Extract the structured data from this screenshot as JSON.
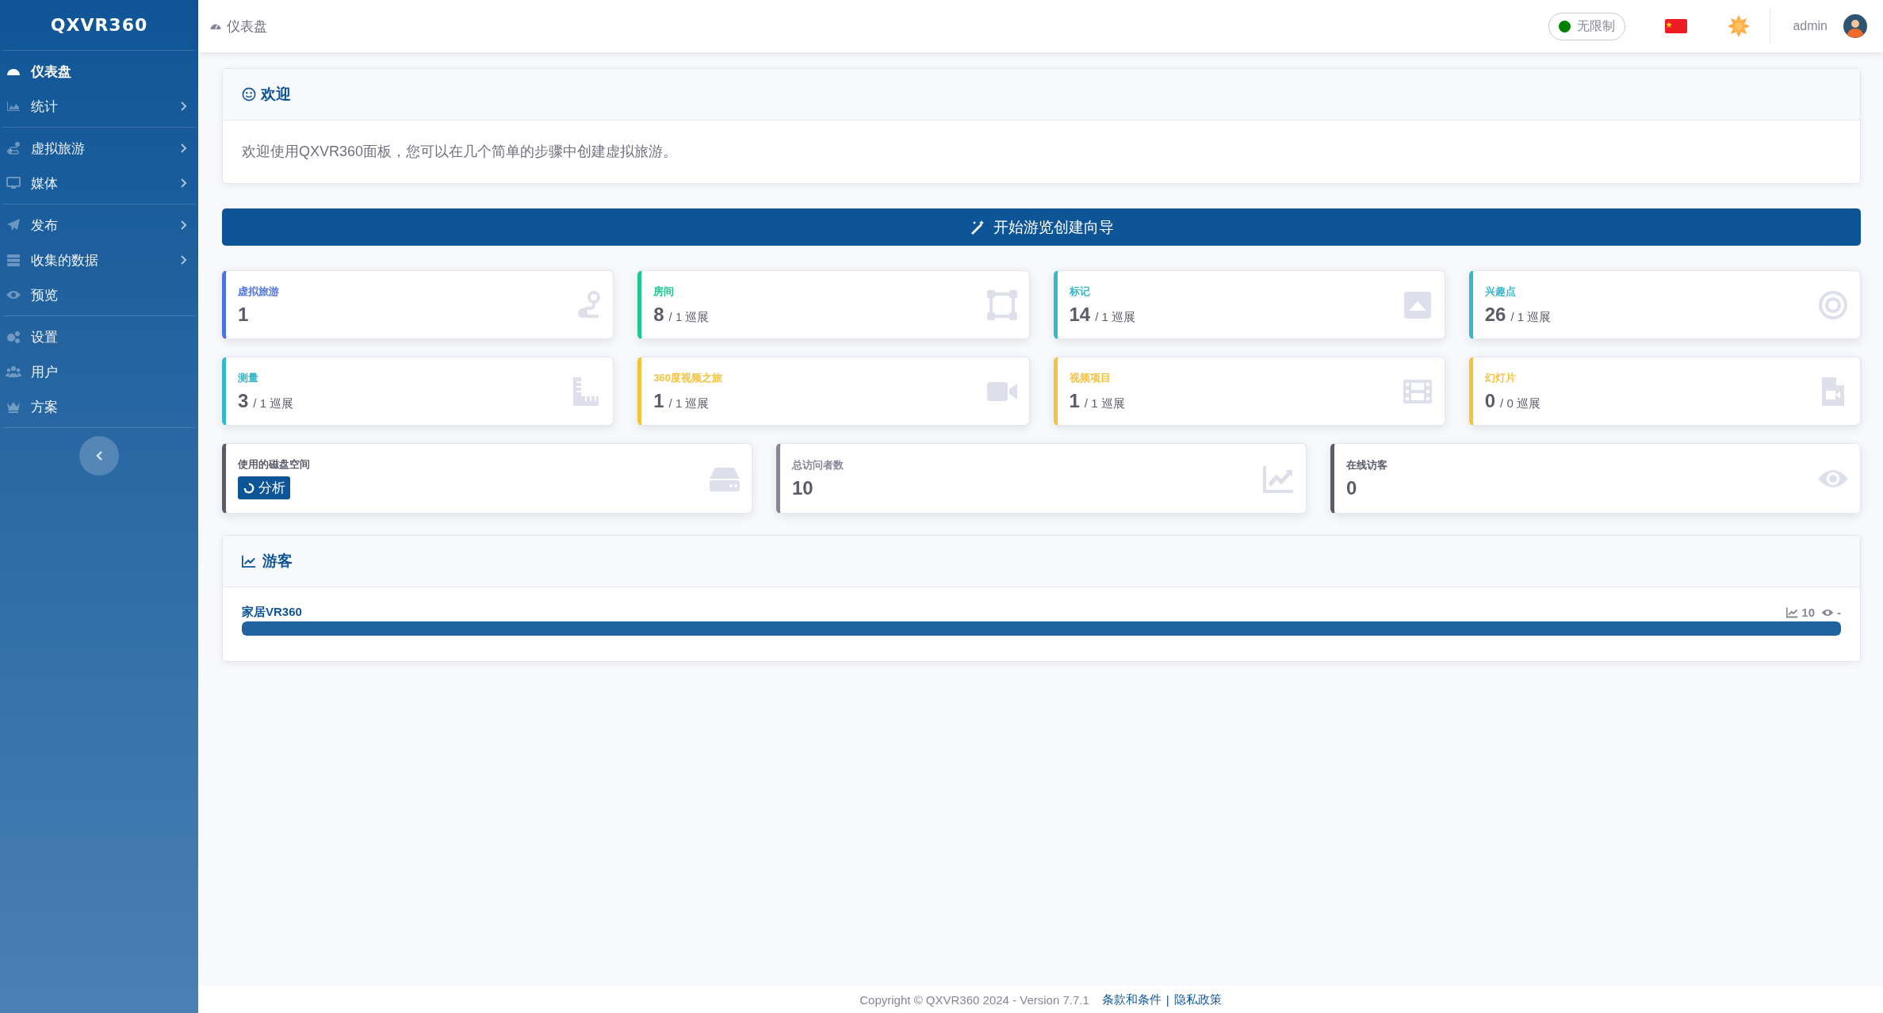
{
  "sidebar": {
    "logo": "QXVR360",
    "groups": [
      {
        "items": [
          {
            "label": "仪表盘",
            "selected": true,
            "expandable": false
          },
          {
            "label": "统计",
            "selected": false,
            "expandable": true
          }
        ]
      },
      {
        "items": [
          {
            "label": "虚拟旅游",
            "selected": false,
            "expandable": true
          },
          {
            "label": "媒体",
            "selected": false,
            "expandable": true
          }
        ]
      },
      {
        "items": [
          {
            "label": "发布",
            "selected": false,
            "expandable": true
          },
          {
            "label": "收集的数据",
            "selected": false,
            "expandable": true
          },
          {
            "label": "预览",
            "selected": false,
            "expandable": false
          }
        ]
      },
      {
        "items": [
          {
            "label": "设置",
            "selected": false,
            "expandable": false
          },
          {
            "label": "用户",
            "selected": false,
            "expandable": false
          },
          {
            "label": "方案",
            "selected": false,
            "expandable": false
          }
        ]
      }
    ]
  },
  "topbar": {
    "breadcrumb": "仪表盘",
    "status": {
      "label": "无限制",
      "color": "#008000"
    },
    "user": "admin"
  },
  "welcome": {
    "title": "欢迎",
    "text": "欢迎使用QXVR360面板，您可以在几个简单的步骤中创建虚拟旅游。"
  },
  "wizard_button": "开始游览创建向导",
  "stat_rows": [
    {
      "cards": [
        {
          "kind": "count",
          "label": "虚拟旅游",
          "value": "1",
          "color": "#4e73df"
        },
        {
          "kind": "count",
          "label": "房间",
          "value": "8",
          "suffix": "/ 1 巡展",
          "color": "#1cc88a"
        },
        {
          "kind": "count",
          "label": "标记",
          "value": "14",
          "suffix": "/ 1 巡展",
          "color": "#36b9cc"
        },
        {
          "kind": "count",
          "label": "兴趣点",
          "value": "26",
          "suffix": "/ 1 巡展",
          "color": "#36b9cc"
        }
      ]
    },
    {
      "cards": [
        {
          "kind": "count",
          "label": "测量",
          "value": "3",
          "suffix": "/ 1 巡展",
          "color": "#36b9cc"
        },
        {
          "kind": "count",
          "label": "360度视频之旅",
          "value": "1",
          "suffix": "/ 1 巡展",
          "color": "#f6c23e"
        },
        {
          "kind": "count",
          "label": "视频项目",
          "value": "1",
          "suffix": "/ 1 巡展",
          "color": "#f6c23e"
        },
        {
          "kind": "count",
          "label": "幻灯片",
          "value": "0",
          "suffix": "/ 0 巡展",
          "color": "#f6c23e"
        }
      ]
    },
    {
      "cards": [
        {
          "kind": "action",
          "label": "使用的磁盘空间",
          "button": "分析",
          "color": "#5a5c69"
        },
        {
          "kind": "count",
          "label": "总访问者数",
          "value": "10",
          "color": "#858796"
        },
        {
          "kind": "count",
          "label": "在线访客",
          "value": "0",
          "color": "#5a5c69"
        }
      ]
    }
  ],
  "visitors": {
    "title": "游客",
    "tours": [
      {
        "name": "家居VR360",
        "visits": "10",
        "online": "-",
        "level": 1
      }
    ]
  },
  "footer": {
    "copyright": "Copyright © QXVR360 2024 - Version 7.7.1",
    "links": [
      {
        "label": "条款和条件"
      },
      {
        "label": "隐私政策"
      }
    ],
    "separator": "|"
  }
}
